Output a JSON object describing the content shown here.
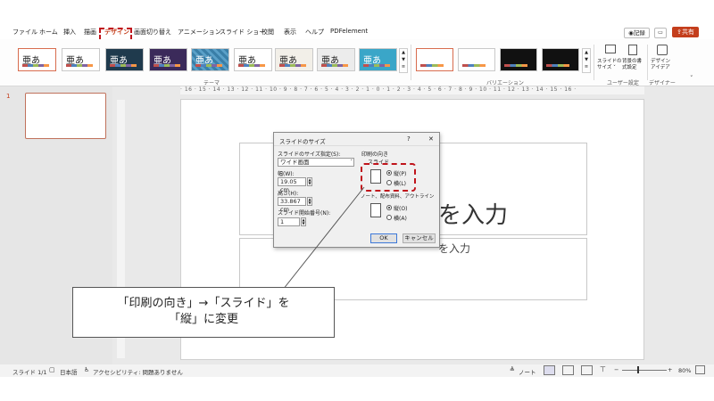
{
  "tabs": [
    "ファイル",
    "ホーム",
    "挿入",
    "描画",
    "デザイン",
    "画面切り替え",
    "アニメーション",
    "スライド ショー",
    "校閲",
    "表示",
    "ヘルプ",
    "PDFelement"
  ],
  "active_tab": "デザイン",
  "top_right": {
    "record": "記録",
    "share": "共有"
  },
  "ribbon": {
    "themes_label": "テーマ",
    "theme_glyph": "亜あ",
    "variations_label": "バリエーション",
    "customize_label": "ユーザー設定",
    "designer_label": "デザイナー",
    "slide_size_btn": "スライドの\nサイズ ˅",
    "bg_format_btn": "背景の書\n式設定",
    "design_ideas_btn": "デザイン\nアイデア"
  },
  "ruler_text": "· 16 · 15 · 14 · 13 · 12 · 11 · 10 · 9 · 8 · 7 · 6 · 5 · 4 · 3 · 2 · 1 · 0 · 1 · 2 · 3 · 4 · 5 · 6 · 7 · 8 · 9 · 10 · 11 · 12 · 13 · 14 · 15 · 16 ·",
  "thumbnail_number": "1",
  "slide": {
    "title_text": "を入力",
    "subtitle_text": "を入力"
  },
  "dialog": {
    "title": "スライドのサイズ",
    "help": "?",
    "close": "✕",
    "size_for_label": "スライドのサイズ指定(S):",
    "size_for_value": "ワイド画面",
    "width_label": "幅(W):",
    "width_value": "19.05 cm",
    "height_label": "高さ(H):",
    "height_value": "33.867 cm",
    "start_label": "スライド開始番号(N):",
    "start_value": "1",
    "orientation_label": "印刷の向き",
    "slides_label": "スライド",
    "portrait": "縦(P)",
    "landscape": "横(L)",
    "notes_label": "ノート、配布資料、アウトライン",
    "notes_portrait": "縦(O)",
    "notes_landscape": "横(A)",
    "ok": "OK",
    "cancel": "キャンセル"
  },
  "callout": {
    "line1": "「印刷の向き」→「スライド」を",
    "line2": "「縦」に変更"
  },
  "status": {
    "slide": "スライド 1/1",
    "lang": "日本語",
    "accessibility": "アクセシビリティ: 問題ありません",
    "notes": "ノート",
    "zoom": "80%"
  },
  "colors": {
    "accent": "#c43e1c",
    "highlight_dash": "#c0141b",
    "share": "#c43e1c"
  }
}
